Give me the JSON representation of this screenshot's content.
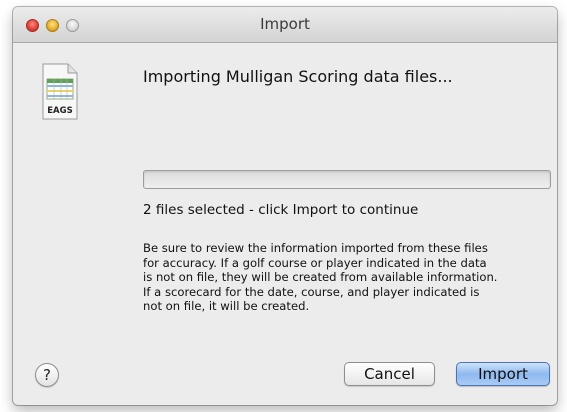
{
  "window": {
    "title": "Import"
  },
  "icon": {
    "name": "eags-document-icon",
    "label": "EAGS"
  },
  "dialog": {
    "heading": "Importing Mulligan Scoring data files...",
    "progress_fraction": 0,
    "status": "2 files selected - click Import to continue",
    "info_lines": [
      "Be sure to review the information imported from these files",
      "for accuracy.  If a golf course or player indicated in the data",
      "is not on file, they will be created from available information.",
      "If a scorecard for the date, course, and player indicated is",
      "not on file, it will be created."
    ]
  },
  "buttons": {
    "help": "?",
    "cancel": "Cancel",
    "import": "Import"
  }
}
